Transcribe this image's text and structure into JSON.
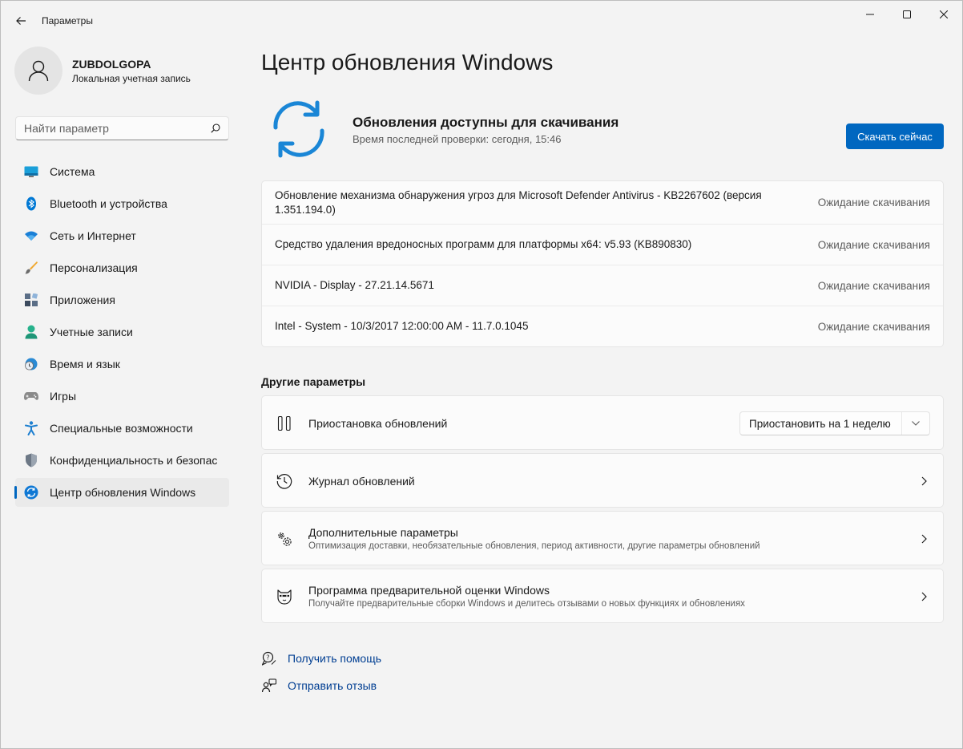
{
  "window": {
    "title": "Параметры"
  },
  "profile": {
    "name": "ZUBDOLGOPA",
    "account_type": "Локальная учетная запись"
  },
  "search": {
    "placeholder": "Найти параметр"
  },
  "sidebar": {
    "items": [
      {
        "label": "Система",
        "icon": "system-icon"
      },
      {
        "label": "Bluetooth и устройства",
        "icon": "bluetooth-icon"
      },
      {
        "label": "Сеть и Интернет",
        "icon": "wifi-icon"
      },
      {
        "label": "Персонализация",
        "icon": "brush-icon"
      },
      {
        "label": "Приложения",
        "icon": "apps-icon"
      },
      {
        "label": "Учетные записи",
        "icon": "accounts-icon"
      },
      {
        "label": "Время и язык",
        "icon": "time-language-icon"
      },
      {
        "label": "Игры",
        "icon": "gamepad-icon"
      },
      {
        "label": "Специальные возможности",
        "icon": "accessibility-icon"
      },
      {
        "label": "Конфиденциальность и безопасность",
        "icon": "shield-icon"
      },
      {
        "label": "Центр обновления Windows",
        "icon": "windows-update-icon",
        "active": true
      }
    ]
  },
  "main": {
    "title": "Центр обновления Windows",
    "status": {
      "title": "Обновления доступны для скачивания",
      "last_check": "Время последней проверки: сегодня, 15:46",
      "download_button": "Скачать сейчас"
    },
    "updates": [
      {
        "name": "Обновление механизма обнаружения угроз для Microsoft Defender Antivirus - KB2267602 (версия 1.351.194.0)",
        "status": "Ожидание скачивания"
      },
      {
        "name": "Средство удаления вредоносных программ для платформы x64: v5.93 (KB890830)",
        "status": "Ожидание скачивания"
      },
      {
        "name": "NVIDIA - Display - 27.21.14.5671",
        "status": "Ожидание скачивания"
      },
      {
        "name": "Intel - System - 10/3/2017 12:00:00 AM - 11.7.0.1045",
        "status": "Ожидание скачивания"
      }
    ],
    "other_section_title": "Другие параметры",
    "options": {
      "pause": {
        "title": "Приостановка обновлений",
        "select_value": "Приостановить на 1 неделю"
      },
      "history": {
        "title": "Журнал обновлений"
      },
      "advanced": {
        "title": "Дополнительные параметры",
        "subtitle": "Оптимизация доставки, необязательные обновления, период активности, другие параметры обновлений"
      },
      "insider": {
        "title": "Программа предварительной оценки Windows",
        "subtitle": "Получайте предварительные сборки Windows и делитесь отзывами о новых функциях и обновлениях"
      }
    },
    "links": {
      "help": "Получить помощь",
      "feedback": "Отправить отзыв"
    }
  },
  "colors": {
    "accent": "#0067c0",
    "link": "#003e92",
    "background": "#f3f3f3",
    "card": "#fbfbfb"
  }
}
